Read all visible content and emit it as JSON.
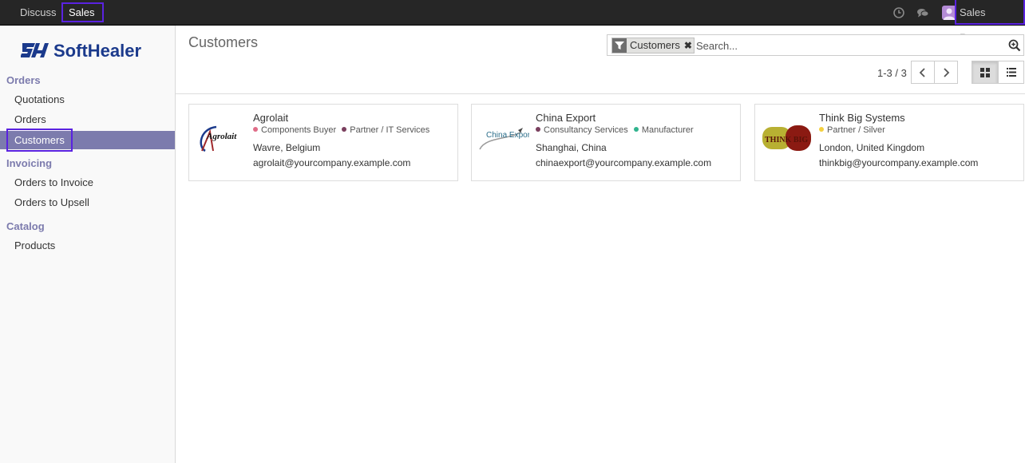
{
  "topbar": {
    "apps": [
      {
        "label": "Discuss"
      },
      {
        "label": "Sales"
      }
    ],
    "user_name": "Sales Person",
    "icons": [
      "clock-icon",
      "chat-icon",
      "user-avatar"
    ]
  },
  "sidebar": {
    "logo_text": "SoftHealer",
    "sections": [
      {
        "title": "Orders",
        "items": [
          "Quotations",
          "Orders",
          "Customers"
        ]
      },
      {
        "title": "Invoicing",
        "items": [
          "Orders to Invoice",
          "Orders to Upsell"
        ]
      },
      {
        "title": "Catalog",
        "items": [
          "Products"
        ]
      }
    ],
    "active_item": "Customers"
  },
  "control_panel": {
    "breadcrumb": "Customers",
    "search": {
      "facet_label": "Customers",
      "placeholder": "Search..."
    },
    "pager": "1-3 / 3"
  },
  "customers": [
    {
      "name": "Agrolait",
      "logo_text": "Agrolait",
      "tags": [
        {
          "label": "Components Buyer",
          "color": "#e06c88"
        },
        {
          "label": "Partner / IT Services",
          "color": "#7a3f5e"
        }
      ],
      "location": "Wavre, Belgium",
      "email": "agrolait@yourcompany.example.com"
    },
    {
      "name": "China Export",
      "logo_text": "China Export",
      "tags": [
        {
          "label": "Consultancy Services",
          "color": "#7a3f5e"
        },
        {
          "label": "Manufacturer",
          "color": "#30b38e"
        }
      ],
      "location": "Shanghai, China",
      "email": "chinaexport@yourcompany.example.com"
    },
    {
      "name": "Think Big Systems",
      "logo_text": "THINK BIG",
      "tags": [
        {
          "label": "Partner / Silver",
          "color": "#f4d03f"
        }
      ],
      "location": "London, United Kingdom",
      "email": "thinkbig@yourcompany.example.com"
    }
  ],
  "colors": {
    "accent": "#7c7bad",
    "topbar": "#262626",
    "highlight": "#5a22e0"
  }
}
